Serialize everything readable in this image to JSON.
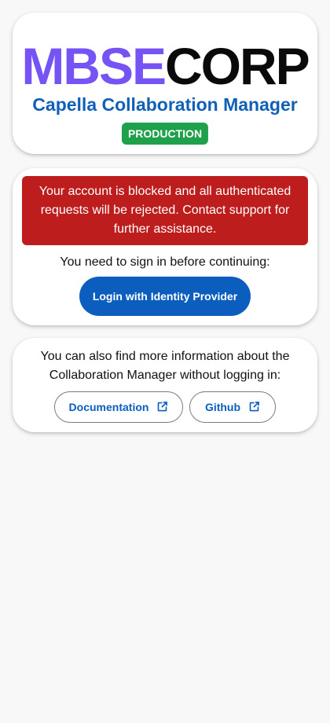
{
  "header": {
    "brand_part_1": "MBSE",
    "brand_part_2": "CORP",
    "subtitle": "Capella Collaboration Manager",
    "environment_badge": "PRODUCTION"
  },
  "login": {
    "alert_text": "Your account is blocked and all authenticated requests will be rejected. Contact support for further assistance.",
    "signin_prompt": "You need to sign in before continuing:",
    "login_button": "Login with Identity Provider"
  },
  "info": {
    "text": "You can also find more information about the Collaboration Manager without logging in:",
    "links": [
      {
        "label": "Documentation",
        "icon": "external-link-icon"
      },
      {
        "label": "Github",
        "icon": "external-link-icon"
      }
    ]
  },
  "colors": {
    "brand_purple": "#7653f5",
    "primary_blue": "#0b5ebd",
    "badge_green": "#1fa04a",
    "alert_red": "#bd1d1d",
    "background": "#f8f8f8"
  }
}
